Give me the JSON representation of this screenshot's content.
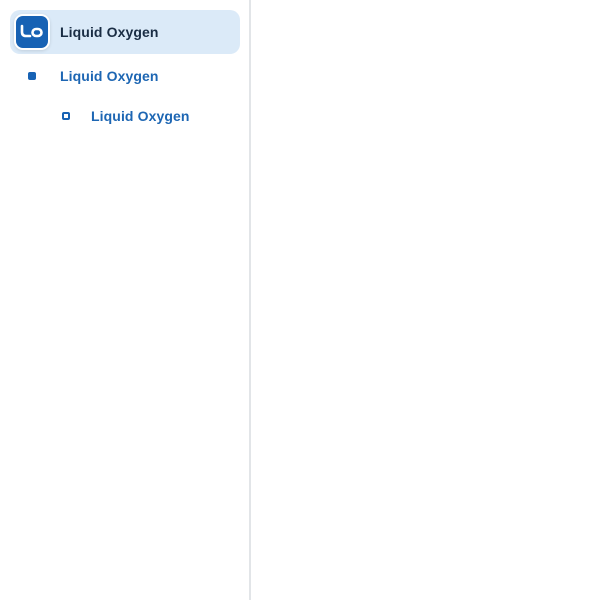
{
  "sidebar": {
    "header": {
      "logo_text": "LO",
      "title": "Liquid Oxygen"
    },
    "items": [
      {
        "label": "Liquid Oxygen",
        "level": 1,
        "bullet": "filled-square"
      },
      {
        "label": "Liquid Oxygen",
        "level": 2,
        "bullet": "hollow-square"
      }
    ]
  },
  "colors": {
    "accent": "#1762b4",
    "active_background": "#dbeaf8",
    "header_text": "#1a2d44",
    "link_text": "#1d66b3",
    "divider": "#e2e5e8"
  }
}
